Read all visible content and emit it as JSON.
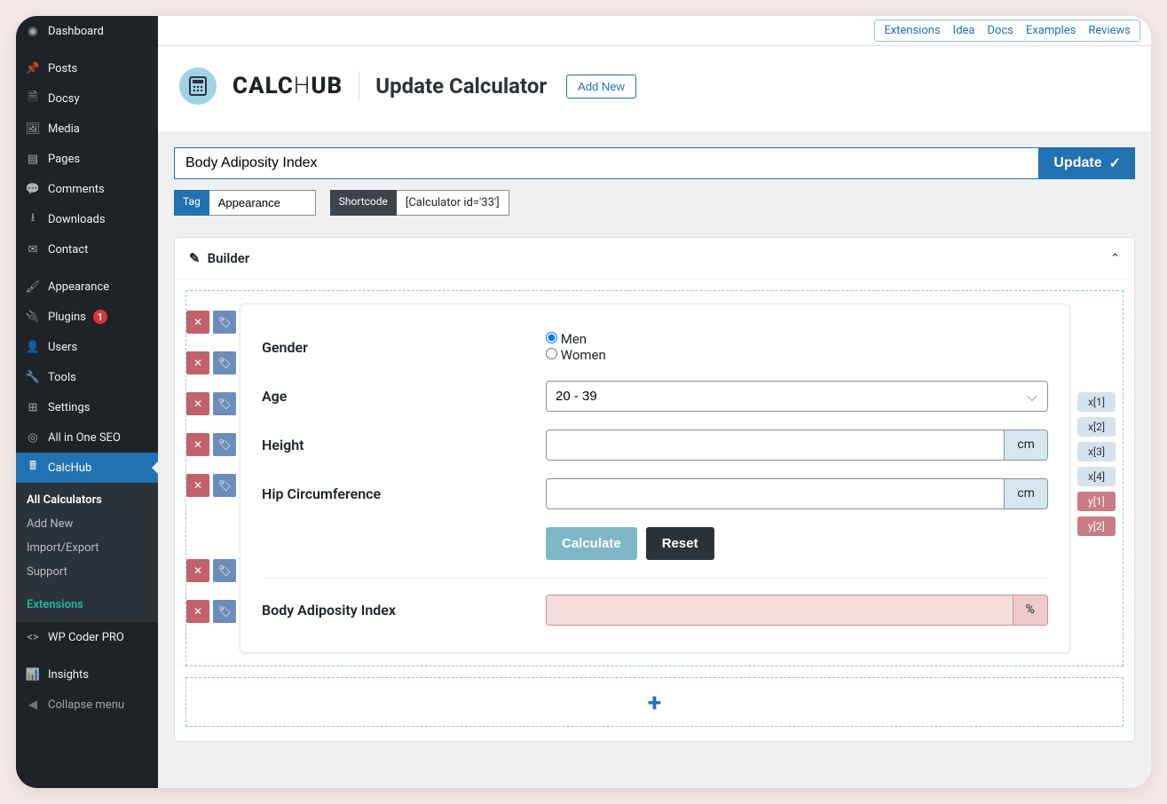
{
  "sidebar": {
    "items": [
      {
        "label": "Dashboard"
      },
      {
        "label": "Posts"
      },
      {
        "label": "Docsy"
      },
      {
        "label": "Media"
      },
      {
        "label": "Pages"
      },
      {
        "label": "Comments"
      },
      {
        "label": "Downloads"
      },
      {
        "label": "Contact"
      },
      {
        "label": "Appearance"
      },
      {
        "label": "Plugins",
        "badge": "1"
      },
      {
        "label": "Users"
      },
      {
        "label": "Tools"
      },
      {
        "label": "Settings"
      },
      {
        "label": "All in One SEO"
      },
      {
        "label": "CalcHub"
      }
    ],
    "submenu": [
      {
        "label": "All Calculators"
      },
      {
        "label": "Add New"
      },
      {
        "label": "Import/Export"
      },
      {
        "label": "Support"
      },
      {
        "label": "Extensions"
      }
    ],
    "wpcoder": "WP Coder PRO",
    "insights": "Insights",
    "collapse": "Collapse menu"
  },
  "topnav": [
    "Extensions",
    "Idea",
    "Docs",
    "Examples",
    "Reviews"
  ],
  "brand": {
    "a": "CALC",
    "b": "H",
    "c": "UB"
  },
  "header": {
    "page_title": "Update Calculator",
    "add_new": "Add New"
  },
  "title_input": "Body Adiposity Index",
  "update_btn": "Update",
  "tags": {
    "tag_label": "Tag",
    "tag_value": "Appearance",
    "shortcode_label": "Shortcode",
    "shortcode_value": "[Calculator id='33']"
  },
  "panel": {
    "title": "Builder"
  },
  "form": {
    "gender_label": "Gender",
    "gender_men": "Men",
    "gender_women": "Women",
    "age_label": "Age",
    "age_value": "20 - 39",
    "height_label": "Height",
    "height_unit": "cm",
    "hip_label": "Hip Circumference",
    "hip_unit": "cm",
    "calc_btn": "Calculate",
    "reset_btn": "Reset",
    "result_label": "Body Adiposity Index",
    "result_unit": "%"
  },
  "vars": [
    "x[1]",
    "x[2]",
    "x[3]",
    "x[4]",
    "y[1]",
    "y[2]"
  ]
}
